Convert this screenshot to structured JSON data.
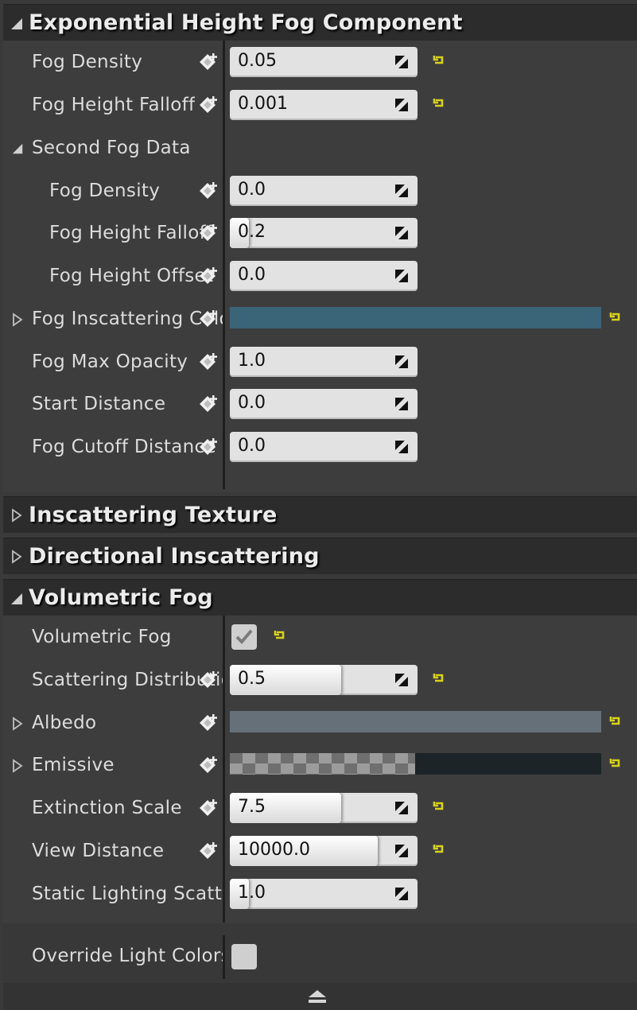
{
  "colors": {
    "accent_reset": "#d8d21a",
    "inscattering_color": "#3a6478",
    "albedo_color": "#667079",
    "emissive_dark": "#1c2428"
  },
  "icons": {
    "expanded": "triangle-down-icon",
    "collapsed": "triangle-right-icon",
    "keyframe": "add-keyframe-icon",
    "reset": "reset-to-default-icon",
    "spinner": "drag-arrows-icon",
    "footer": "collapse-up-icon"
  },
  "sections": {
    "fog": "Exponential Height Fog Component",
    "inscattering_texture": "Inscattering Texture",
    "directional": "Directional Inscattering",
    "volumetric": "Volumetric Fog"
  },
  "fog": {
    "fog_density": {
      "label": "Fog Density",
      "value": "0.05",
      "fill": 0
    },
    "fog_height_falloff": {
      "label": "Fog Height Falloff",
      "value": "0.001",
      "fill": 0
    },
    "second_fog_data": {
      "label": "Second Fog Data"
    },
    "second_fog_density": {
      "label": "Fog Density",
      "value": "0.0",
      "fill": 0
    },
    "second_fog_height_falloff": {
      "label": "Fog Height Falloff",
      "value": "0.2",
      "fill": 0.1
    },
    "second_fog_height_offset": {
      "label": "Fog Height Offset",
      "value": "0.0",
      "fill": 0
    },
    "fog_inscattering_color": {
      "label": "Fog Inscattering Color"
    },
    "fog_max_opacity": {
      "label": "Fog Max Opacity",
      "value": "1.0",
      "fill": 0
    },
    "start_distance": {
      "label": "Start Distance",
      "value": "0.0",
      "fill": 0
    },
    "fog_cutoff_distance": {
      "label": "Fog Cutoff Distance",
      "value": "0.0",
      "fill": 0
    }
  },
  "volumetric": {
    "volumetric_fog": {
      "label": "Volumetric Fog",
      "checked": true
    },
    "scattering_distribution": {
      "label": "Scattering Distribution",
      "value": "0.5",
      "fill": 0.75
    },
    "albedo": {
      "label": "Albedo"
    },
    "emissive": {
      "label": "Emissive"
    },
    "extinction_scale": {
      "label": "Extinction Scale",
      "value": "7.5",
      "fill": 0.75
    },
    "view_distance": {
      "label": "View Distance",
      "value": "10000.0",
      "fill": 1.0
    },
    "static_lighting_scattering": {
      "label": "Static Lighting Scattering Intensity",
      "value": "1.0",
      "fill": 0.1
    },
    "override_light_colors": {
      "label": "Override Light Colors with Fog Inscattering Colors",
      "checked": false
    }
  }
}
